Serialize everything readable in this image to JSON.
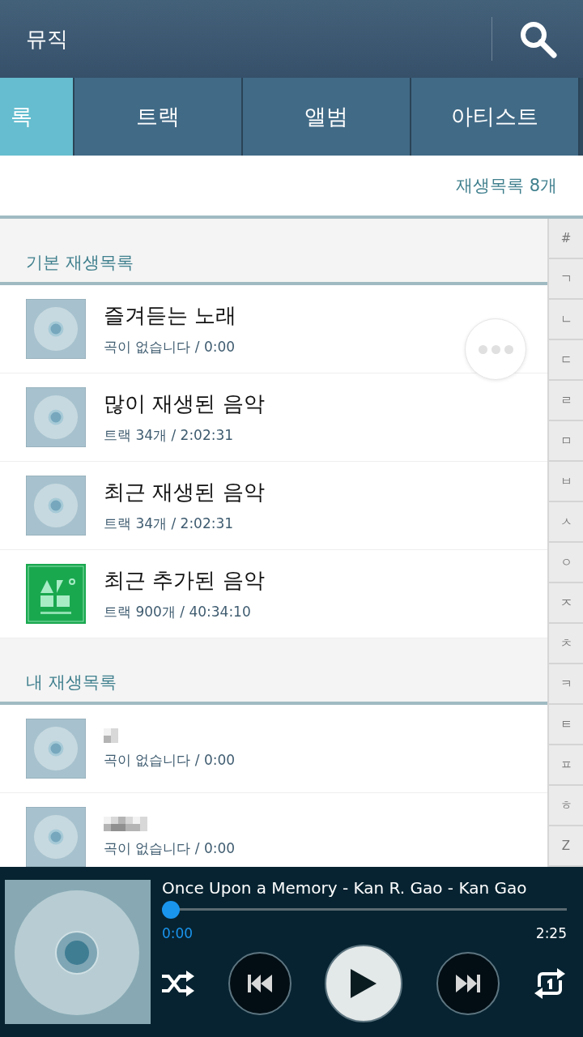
{
  "header": {
    "title": "뮤직"
  },
  "tabs": [
    {
      "label": "록",
      "selected": true
    },
    {
      "label": "트랙",
      "selected": false
    },
    {
      "label": "앨범",
      "selected": false
    },
    {
      "label": "아티스트",
      "selected": false
    }
  ],
  "playlist_count": "재생목록 8개",
  "index": [
    "#",
    "ㄱ",
    "ㄴ",
    "ㄷ",
    "ㄹ",
    "ㅁ",
    "ㅂ",
    "ㅅ",
    "ㅇ",
    "ㅈ",
    "ㅊ",
    "ㅋ",
    "ㅌ",
    "ㅍ",
    "ㅎ",
    "Z"
  ],
  "sections": [
    {
      "title": "기본 재생목록",
      "items": [
        {
          "name": "즐겨듣는 노래",
          "info": "곡이 없습니다 / 0:00",
          "kind": "disc",
          "name_hidden": false
        },
        {
          "name": "많이 재생된 음악",
          "info": "트랙 34개 / 2:02:31",
          "kind": "disc",
          "name_hidden": false
        },
        {
          "name": "최근 재생된 음악",
          "info": "트랙 34개 / 2:02:31",
          "kind": "disc",
          "name_hidden": false
        },
        {
          "name": "최근 추가된 음악",
          "info": "트랙 900개 / 40:34:10",
          "kind": "art",
          "name_hidden": false
        }
      ]
    },
    {
      "title": "내 재생목록",
      "items": [
        {
          "info": "곡이 없습니다 / 0:00",
          "kind": "disc",
          "name_hidden": true
        },
        {
          "info": "곡이 없습니다 / 0:00",
          "kind": "disc",
          "name_hidden": true
        }
      ]
    }
  ],
  "player": {
    "track": "Once Upon a Memory - Kan R. Gao - Kan Gao",
    "level": 0.0,
    "elapsed": "0:00",
    "duration": "2:25",
    "playing": false,
    "shuffle": true,
    "repeat_one": true
  }
}
